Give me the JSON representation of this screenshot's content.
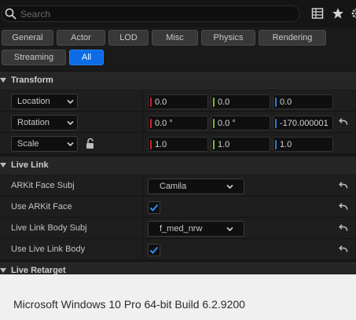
{
  "search": {
    "placeholder": "Search",
    "value": ""
  },
  "toolbar": {
    "icons": [
      "table-view-icon",
      "star-icon",
      "settings-icon"
    ]
  },
  "filters": {
    "row1": [
      "General",
      "Actor",
      "LOD",
      "Misc",
      "Physics",
      "Rendering"
    ],
    "row2": [
      "Streaming",
      "All"
    ],
    "active": "All"
  },
  "transform": {
    "title": "Transform",
    "location": {
      "mode": "Location",
      "x": "0.0",
      "y": "0.0",
      "z": "0.0"
    },
    "rotation": {
      "mode": "Rotation",
      "x": "0.0 °",
      "y": "0.0 °",
      "z": "-170.000001"
    },
    "scale": {
      "mode": "Scale",
      "x": "1.0",
      "y": "1.0",
      "z": "1.0"
    }
  },
  "live_link": {
    "title": "Live Link",
    "arkit_face_subj": {
      "label": "ARKit Face Subj",
      "value": "Camila"
    },
    "use_arkit_face": {
      "label": "Use ARKit Face",
      "checked": true
    },
    "body_subj": {
      "label": "Live Link Body Subj",
      "value": "f_med_nrw"
    },
    "use_body": {
      "label": "Use Live Link Body",
      "checked": true
    }
  },
  "live_retarget": {
    "title": "Live Retarget"
  },
  "footer": {
    "text": "Microsoft Windows 10 Pro 64-bit Build 6.2.9200"
  },
  "colors": {
    "accent": "#0b6ce6",
    "axis_x": "#d0232a",
    "axis_y": "#6fbf2a",
    "axis_z": "#2a78e0"
  }
}
